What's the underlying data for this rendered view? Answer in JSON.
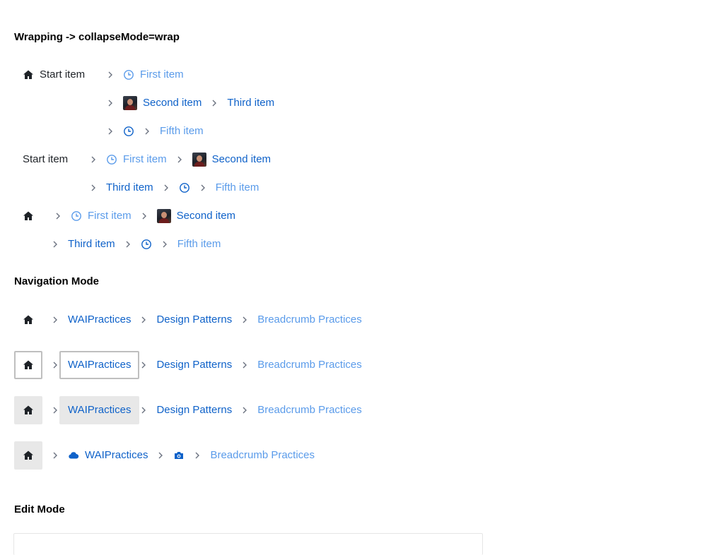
{
  "sections": {
    "wrapping": "Wrapping -> collapseMode=wrap",
    "navigation": "Navigation Mode",
    "edit": "Edit Mode"
  },
  "wrap_labels": {
    "start": "Start item",
    "first": "First item",
    "second": "Second item",
    "third": "Third item",
    "fifth": "Fifth item"
  },
  "nav_labels": {
    "wai": "WAIPractices",
    "design": "Design Patterns",
    "breadcrumb": "Breadcrumb Practices"
  },
  "icons": {
    "home": "home-icon",
    "clock": "clock-icon",
    "avatar": "avatar-icon",
    "chevron": "chevron-right-icon",
    "cloud": "cloud-icon",
    "camera": "camera-icon"
  },
  "colors": {
    "link": "#0f62c9",
    "current": "#5a9bea",
    "focus_outline": "#bfbfbf",
    "hover_fill": "#e8e8e8"
  }
}
